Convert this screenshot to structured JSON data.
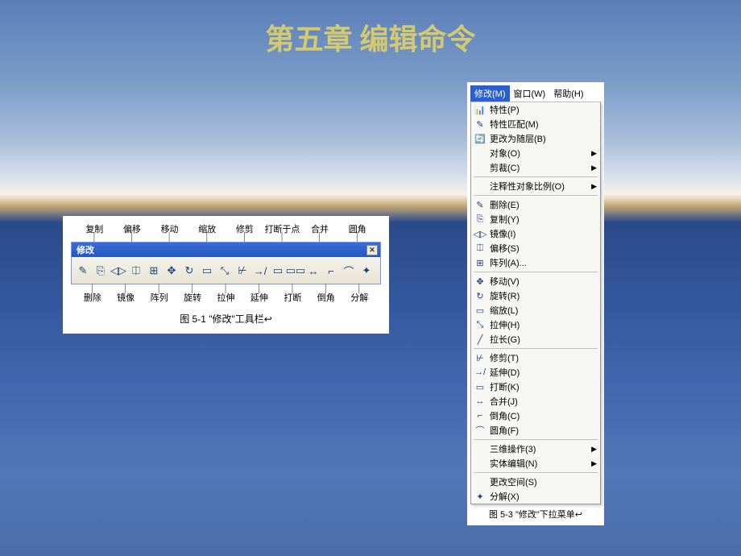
{
  "title": "第五章 编辑命令",
  "toolbar": {
    "top_labels": [
      "复制",
      "偏移",
      "移动",
      "缩放",
      "修剪",
      "打断于点",
      "合并",
      "圆角"
    ],
    "window_title": "修改",
    "close_glyph": "✕",
    "icons": [
      {
        "name": "erase-icon",
        "glyph": "✎"
      },
      {
        "name": "copy-icon",
        "glyph": "⎘"
      },
      {
        "name": "mirror-icon",
        "glyph": "◁▷"
      },
      {
        "name": "offset-icon",
        "glyph": "⎅"
      },
      {
        "name": "array-icon",
        "glyph": "⊞"
      },
      {
        "name": "move-icon",
        "glyph": "✥"
      },
      {
        "name": "rotate-icon",
        "glyph": "↻"
      },
      {
        "name": "scale-icon",
        "glyph": "▭"
      },
      {
        "name": "stretch-icon",
        "glyph": "⤡"
      },
      {
        "name": "trim-icon",
        "glyph": "⊬"
      },
      {
        "name": "extend-icon",
        "glyph": "→/"
      },
      {
        "name": "break-point-icon",
        "glyph": "▭"
      },
      {
        "name": "break-icon",
        "glyph": "▭▭"
      },
      {
        "name": "join-icon",
        "glyph": "↔"
      },
      {
        "name": "chamfer-icon",
        "glyph": "⌐"
      },
      {
        "name": "fillet-icon",
        "glyph": "⌒"
      },
      {
        "name": "explode-icon",
        "glyph": "✦"
      }
    ],
    "bottom_labels": [
      "删除",
      "镜像",
      "阵列",
      "旋转",
      "拉伸",
      "延伸",
      "打断",
      "倒角",
      "分解"
    ],
    "caption": "图 5-1  \"修改\"工具栏↩"
  },
  "menu": {
    "bar": [
      "修改(M)",
      "窗口(W)",
      "帮助(H)"
    ],
    "groups": [
      [
        {
          "icon": "📊",
          "label": "特性(P)"
        },
        {
          "icon": "✎",
          "label": "特性匹配(M)"
        },
        {
          "icon": "🔄",
          "label": "更改为随层(B)"
        },
        {
          "icon": "",
          "label": "对象(O)",
          "sub": true
        },
        {
          "icon": "",
          "label": "剪裁(C)",
          "sub": true
        }
      ],
      [
        {
          "icon": "",
          "label": "注释性对象比例(O)",
          "sub": true
        }
      ],
      [
        {
          "icon": "✎",
          "label": "删除(E)"
        },
        {
          "icon": "⎘",
          "label": "复制(Y)"
        },
        {
          "icon": "◁▷",
          "label": "镜像(I)"
        },
        {
          "icon": "⎅",
          "label": "偏移(S)"
        },
        {
          "icon": "⊞",
          "label": "阵列(A)..."
        }
      ],
      [
        {
          "icon": "✥",
          "label": "移动(V)"
        },
        {
          "icon": "↻",
          "label": "旋转(R)"
        },
        {
          "icon": "▭",
          "label": "缩放(L)"
        },
        {
          "icon": "⤡",
          "label": "拉伸(H)"
        },
        {
          "icon": "╱",
          "label": "拉长(G)"
        }
      ],
      [
        {
          "icon": "⊬",
          "label": "修剪(T)"
        },
        {
          "icon": "→/",
          "label": "延伸(D)"
        },
        {
          "icon": "▭",
          "label": "打断(K)"
        },
        {
          "icon": "↔",
          "label": "合并(J)"
        },
        {
          "icon": "⌐",
          "label": "倒角(C)"
        },
        {
          "icon": "⌒",
          "label": "圆角(F)"
        }
      ],
      [
        {
          "icon": "",
          "label": "三维操作(3)",
          "sub": true
        },
        {
          "icon": "",
          "label": "实体编辑(N)",
          "sub": true
        }
      ],
      [
        {
          "icon": "",
          "label": "更改空间(S)"
        },
        {
          "icon": "✦",
          "label": "分解(X)"
        }
      ]
    ],
    "caption": "图 5-3  \"修改\"下拉菜单↩"
  }
}
